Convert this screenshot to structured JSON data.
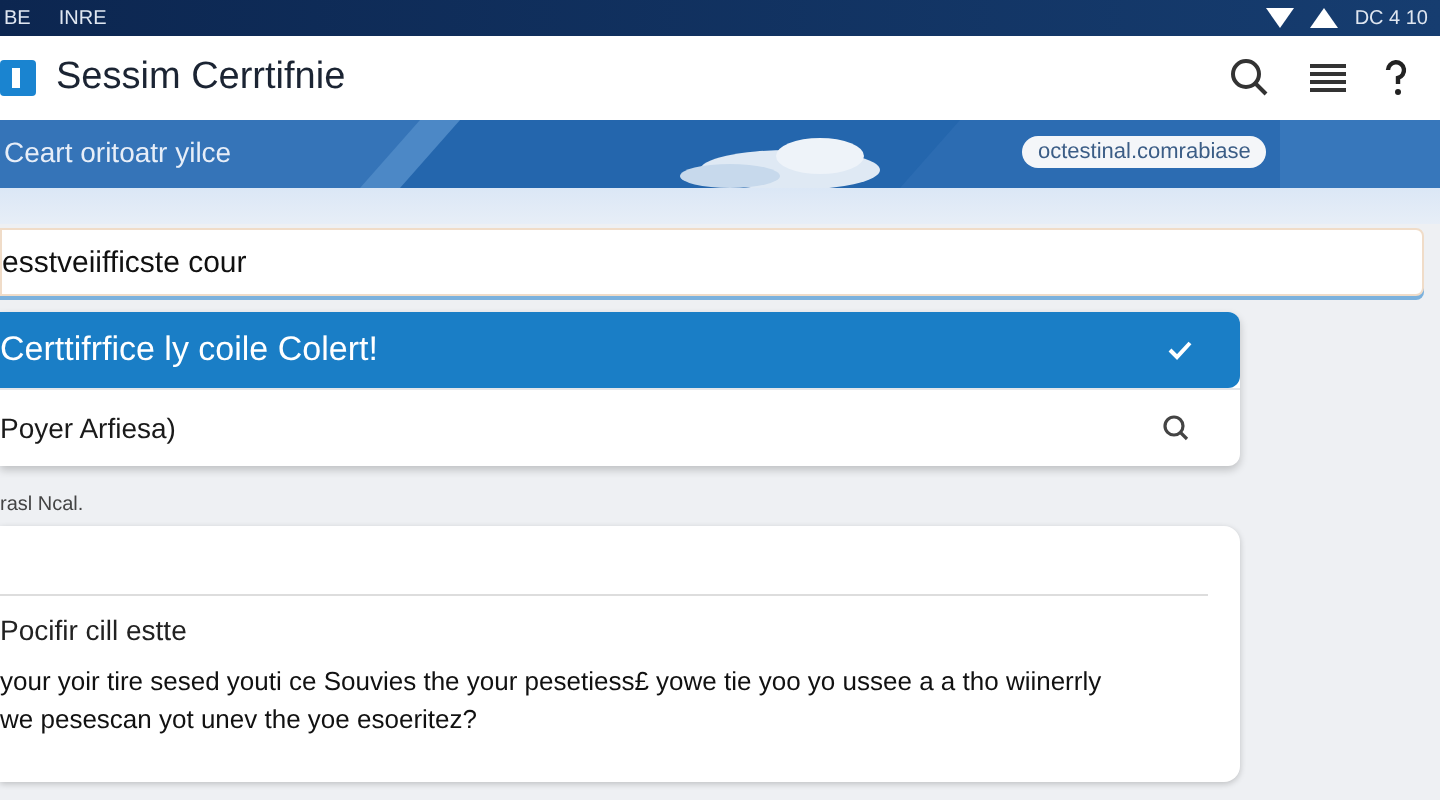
{
  "status_bar": {
    "left": [
      "BE",
      "INRE"
    ],
    "right": "DC 4 10"
  },
  "app_bar": {
    "title": "Sessim Cerrtifnie"
  },
  "banner": {
    "text": "Ceart oritoatr yilce",
    "pill": "octestinal.comrabiase"
  },
  "search": {
    "value": "esstveiifficste cour"
  },
  "suggestions": [
    {
      "label": "Certtifrfice ly coile Colert!",
      "selected": true
    },
    {
      "label": "Poyer Arfiesa)",
      "selected": false
    }
  ],
  "section_label": "rasl Ncal.",
  "card": {
    "title": "Pocifir cill estte",
    "body": "your yoir tire sesed youti ce Souvies the your pesetiess£ yowe tie yoo yo ussee a a tho wiinerrly we pesescan yot unev the yoe esoeritez?"
  }
}
